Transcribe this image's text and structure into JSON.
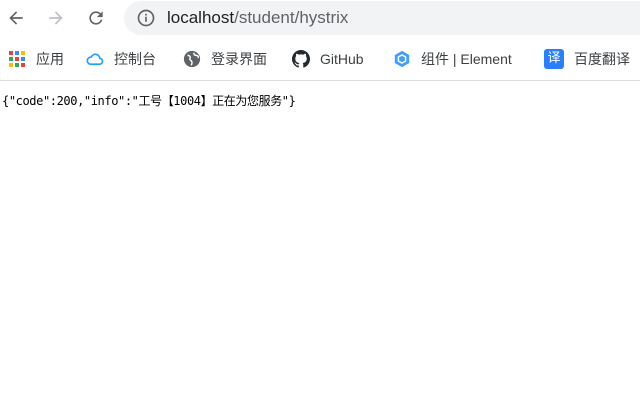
{
  "browser": {
    "url_host": "localhost",
    "url_path": "/student/hystrix",
    "nav": {
      "back_icon": "arrow-left-icon",
      "forward_icon": "arrow-right-icon",
      "reload_icon": "reload-icon",
      "site_info_icon": "info-icon"
    }
  },
  "bookmarks": [
    {
      "label": "应用",
      "icon": "apps-grid-icon"
    },
    {
      "label": "控制台",
      "icon": "cloud-icon"
    },
    {
      "label": "登录界面",
      "icon": "globe-icon"
    },
    {
      "label": "GitHub",
      "icon": "github-icon"
    },
    {
      "label": "组件 | Element",
      "icon": "element-icon"
    },
    {
      "label": "百度翻译",
      "icon": "translate-icon"
    }
  ],
  "page": {
    "body_text": "{\"code\":200,\"info\":\"工号【1004】正在为您服务\"}"
  },
  "colors": {
    "omnibox_bg": "#f1f3f4",
    "element_blue": "#409eff",
    "translate_blue": "#2a7fff"
  }
}
